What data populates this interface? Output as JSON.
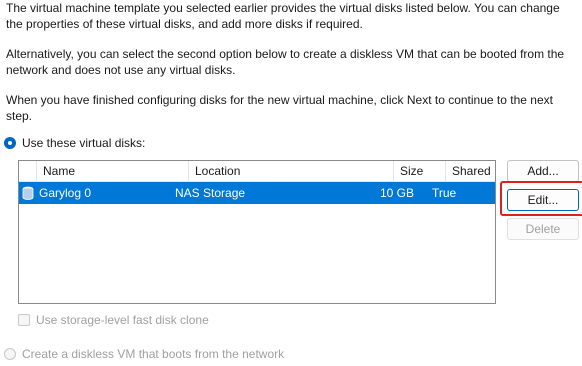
{
  "intro": {
    "p1": "The virtual machine template you selected earlier provides the virtual disks listed below. You can change the properties of these virtual disks, and add more disks if required.",
    "p2": "Alternatively, you can select the second option below to create a diskless VM that can be booted from the network and does not use any virtual disks.",
    "p3": "When you have finished configuring disks for the new virtual machine, click Next to continue to the next step."
  },
  "options": {
    "use_disks_label": "Use these virtual disks:",
    "diskless_label": "Create a diskless VM that boots from the network",
    "fast_clone_label": "Use storage-level fast disk clone"
  },
  "table": {
    "columns": [
      "Name",
      "Location",
      "Size",
      "Shared"
    ],
    "rows": [
      {
        "name": "Garylog 0",
        "location": "NAS Storage",
        "size": "10 GB",
        "shared": "True"
      }
    ]
  },
  "buttons": {
    "add": "Add...",
    "edit": "Edit...",
    "delete": "Delete"
  },
  "colors": {
    "selection": "#0078d7",
    "accent": "#0067c0",
    "highlight": "#e02020"
  },
  "icons": {
    "disk": "disk-stack-icon"
  }
}
